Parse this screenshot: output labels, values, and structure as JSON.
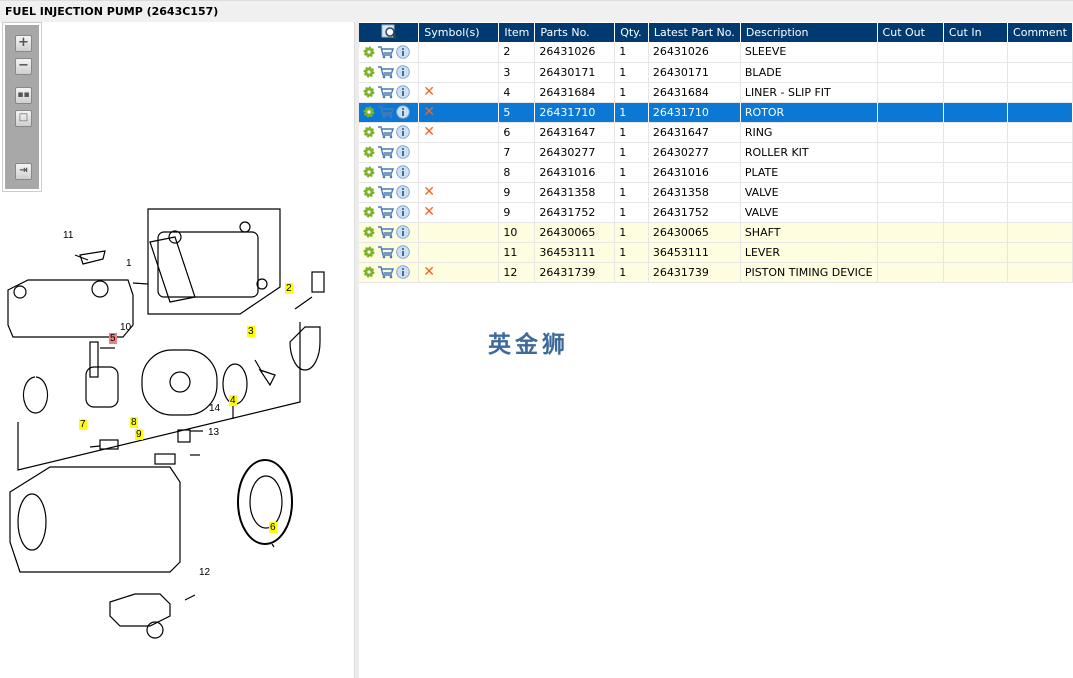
{
  "title": "FUEL INJECTION PUMP (2643C157)",
  "toolbar": {
    "buttons": [
      "zoom-in",
      "zoom-out",
      "fit-all",
      "actual-size",
      "export"
    ]
  },
  "columns": [
    "",
    "Symbol(s)",
    "Item",
    "Parts No.",
    "Qty.",
    "Latest Part No.",
    "Description",
    "Cut Out",
    "Cut In",
    "Comment"
  ],
  "rows": [
    {
      "item": "2",
      "part": "26431026",
      "qty": "1",
      "latest": "26431026",
      "desc": "SLEEVE",
      "symbol": "",
      "state": ""
    },
    {
      "item": "3",
      "part": "26430171",
      "qty": "1",
      "latest": "26430171",
      "desc": "BLADE",
      "symbol": "",
      "state": ""
    },
    {
      "item": "4",
      "part": "26431684",
      "qty": "1",
      "latest": "26431684",
      "desc": "LINER - SLIP FIT",
      "symbol": "x",
      "state": ""
    },
    {
      "item": "5",
      "part": "26431710",
      "qty": "1",
      "latest": "26431710",
      "desc": "ROTOR",
      "symbol": "x",
      "state": "selected"
    },
    {
      "item": "6",
      "part": "26431647",
      "qty": "1",
      "latest": "26431647",
      "desc": "RING",
      "symbol": "x",
      "state": ""
    },
    {
      "item": "7",
      "part": "26430277",
      "qty": "1",
      "latest": "26430277",
      "desc": "ROLLER KIT",
      "symbol": "",
      "state": ""
    },
    {
      "item": "8",
      "part": "26431016",
      "qty": "1",
      "latest": "26431016",
      "desc": "PLATE",
      "symbol": "",
      "state": ""
    },
    {
      "item": "9",
      "part": "26431358",
      "qty": "1",
      "latest": "26431358",
      "desc": "VALVE",
      "symbol": "x",
      "state": ""
    },
    {
      "item": "9",
      "part": "26431752",
      "qty": "1",
      "latest": "26431752",
      "desc": "VALVE",
      "symbol": "x",
      "state": ""
    },
    {
      "item": "10",
      "part": "26430065",
      "qty": "1",
      "latest": "26430065",
      "desc": "SHAFT",
      "symbol": "",
      "state": "highlight"
    },
    {
      "item": "11",
      "part": "36453111",
      "qty": "1",
      "latest": "36453111",
      "desc": "LEVER",
      "symbol": "",
      "state": "highlight"
    },
    {
      "item": "12",
      "part": "26431739",
      "qty": "1",
      "latest": "26431739",
      "desc": "PISTON TIMING DEVICE",
      "symbol": "x",
      "state": "highlight"
    }
  ],
  "callouts": [
    {
      "n": "11",
      "hl": ""
    },
    {
      "n": "1",
      "hl": ""
    },
    {
      "n": "2",
      "hl": "yellow"
    },
    {
      "n": "10",
      "hl": ""
    },
    {
      "n": "5",
      "hl": "red"
    },
    {
      "n": "3",
      "hl": "yellow"
    },
    {
      "n": "4",
      "hl": "yellow"
    },
    {
      "n": "14",
      "hl": ""
    },
    {
      "n": "7",
      "hl": "yellow"
    },
    {
      "n": "8",
      "hl": "yellow"
    },
    {
      "n": "9",
      "hl": "yellow"
    },
    {
      "n": "13",
      "hl": ""
    },
    {
      "n": "6",
      "hl": "yellow"
    },
    {
      "n": "12",
      "hl": ""
    }
  ],
  "watermark": "英金狮",
  "colors": {
    "header": "#003a70",
    "selected": "#0a78d4",
    "highlight_row": "#fffde0",
    "symbol_x": "#f26522",
    "callout_yellow": "#ffff00",
    "callout_red": "#f08080"
  }
}
